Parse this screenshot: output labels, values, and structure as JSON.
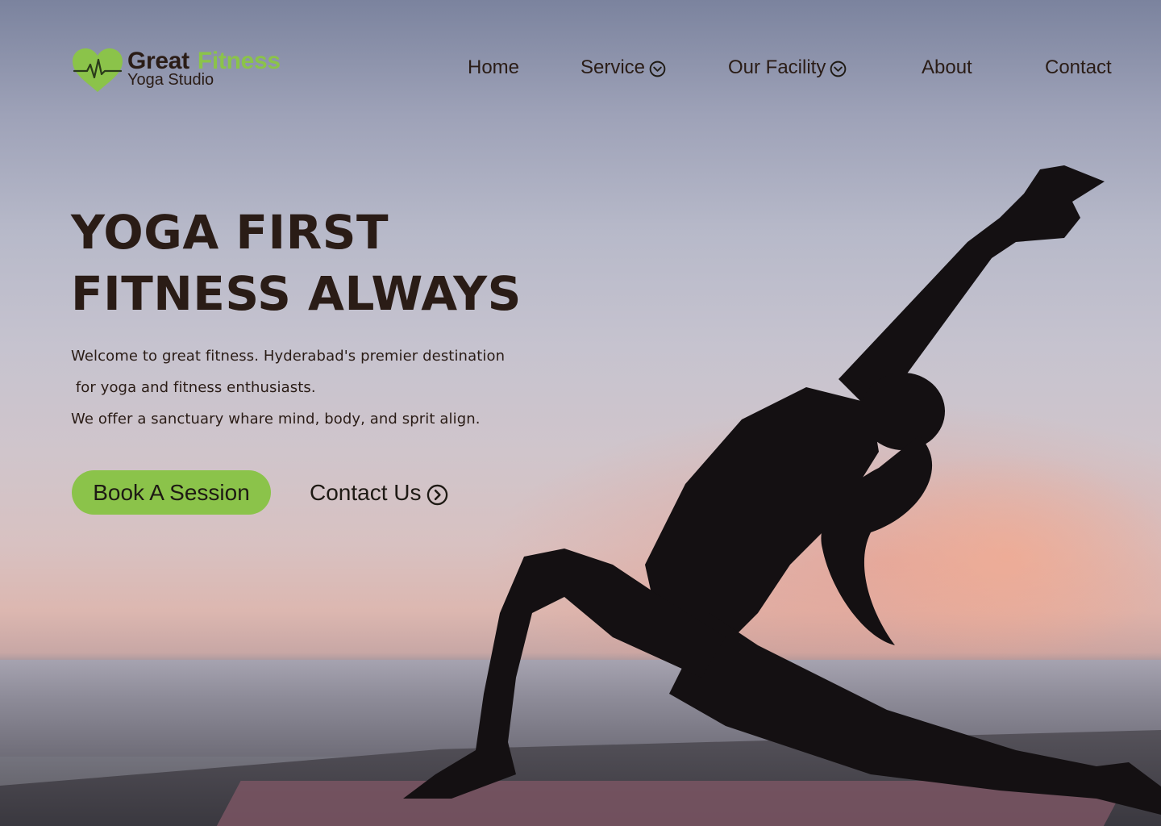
{
  "brand": {
    "name_part1": "Great",
    "name_part2": "Fitness",
    "tagline": "Yoga Studio",
    "logo_icon": "heart-pulse-icon",
    "accent_color": "#8bc34a"
  },
  "nav": {
    "items": [
      {
        "label": "Home"
      },
      {
        "label": "Service",
        "icon": "chevron-down-circle-icon"
      },
      {
        "label": "Our Facility",
        "icon": "chevron-down-circle-icon"
      },
      {
        "label": "About"
      },
      {
        "label": "Contact"
      }
    ]
  },
  "hero": {
    "title_line1": "YOGA FIRST",
    "title_line2": "FITNESS ALWAYS",
    "desc_line1": "Welcome to great fitness. Hyderabad's premier destination",
    "desc_line2": " for yoga and fitness enthusiasts.",
    "desc_line3": "We offer a sanctuary whare mind, body, and sprit align.",
    "primary_button": "Book A Session",
    "secondary_button": "Contact Us",
    "secondary_icon": "chevron-right-circle-icon"
  },
  "colors": {
    "text": "#2a1c16",
    "button_bg": "#8bc34a"
  }
}
